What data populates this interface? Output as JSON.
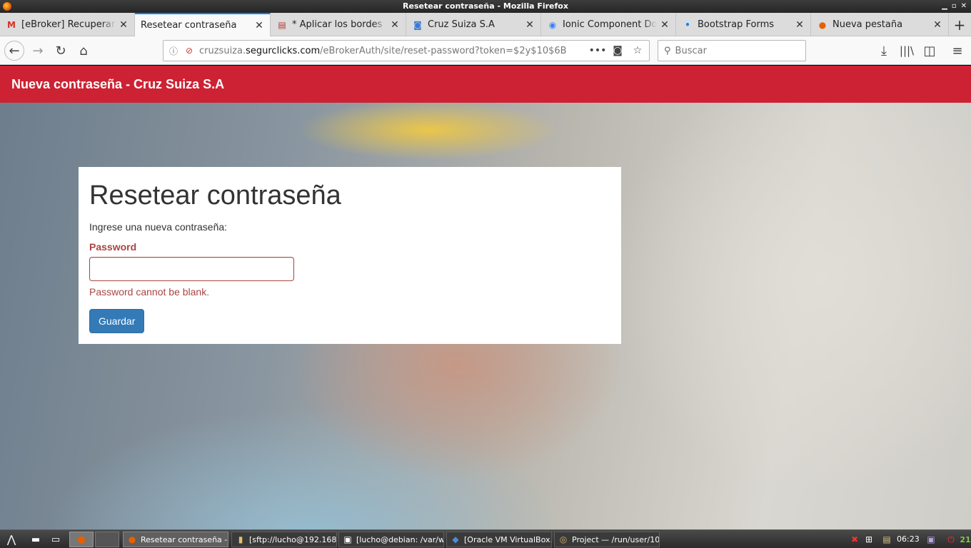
{
  "window": {
    "title": "Resetear contraseña - Mozilla Firefox"
  },
  "tabs": [
    {
      "label": "[eBroker] Recuperar",
      "icon": "gmail-icon"
    },
    {
      "label": "Resetear contraseña",
      "icon": "none",
      "active": true
    },
    {
      "label": "* Aplicar los bordes",
      "icon": "document-icon"
    },
    {
      "label": "Cruz Suiza S.A",
      "icon": "page-icon"
    },
    {
      "label": "Ionic Component Do",
      "icon": "ionic-icon"
    },
    {
      "label": "Bootstrap Forms",
      "icon": "dot-icon"
    },
    {
      "label": "Nueva pestaña",
      "icon": "firefox-icon"
    }
  ],
  "urlbar": {
    "prefix": "cruzsuiza.",
    "domain": "segurclicks.com",
    "path": "/eBrokerAuth/site/reset-password?token=$2y$10$6B"
  },
  "search": {
    "placeholder": "Buscar"
  },
  "page": {
    "header_title": "Nueva contraseña - Cruz Suiza S.A",
    "heading": "Resetear contraseña",
    "intro": "Ingrese una nueva contraseña:",
    "password_label": "Password",
    "password_value": "",
    "error_text": "Password cannot be blank.",
    "submit_label": "Guardar",
    "colors": {
      "header": "#cd2233",
      "error": "#a94442",
      "button": "#337ab7"
    }
  },
  "taskbar": {
    "items": [
      {
        "label": "Resetear contraseña - ...",
        "icon": "firefox-icon",
        "active": true
      },
      {
        "label": "[sftp://lucho@192.168....",
        "icon": "folder-icon"
      },
      {
        "label": "[lucho@debian: /var/w...",
        "icon": "terminal-icon"
      },
      {
        "label": "[Oracle VM VirtualBox...",
        "icon": "virtualbox-icon"
      },
      {
        "label": "Project — /run/user/10...",
        "icon": "atom-icon"
      }
    ],
    "clock": "06:23",
    "extra": "21"
  }
}
